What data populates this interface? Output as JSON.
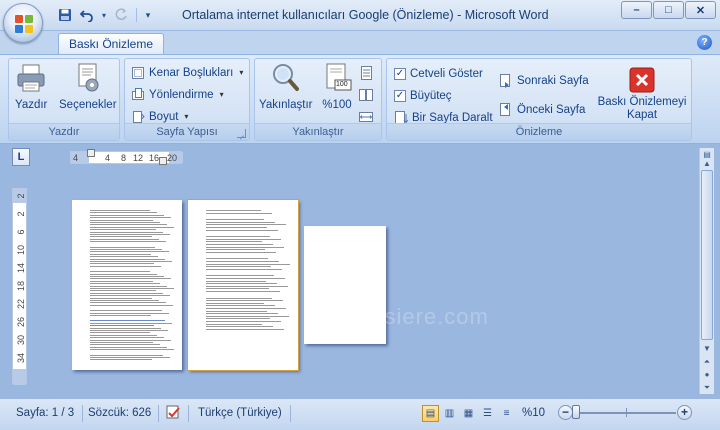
{
  "window": {
    "title": "Ortalama internet kullanıcıları Google (Önizleme) - Microsoft Word",
    "controls": {
      "minimize": "–",
      "maximize": "□",
      "close": "✕"
    }
  },
  "qat": {
    "save_icon": "save-icon",
    "undo_icon": "undo-icon",
    "redo_icon": "redo-icon"
  },
  "ribbon": {
    "active_tab": "Baskı Önizleme",
    "help_label": "?",
    "groups": {
      "print": {
        "label": "Yazdır",
        "print_button": "Yazdır",
        "options_button": "Seçenekler"
      },
      "page_setup": {
        "label": "Sayfa Yapısı",
        "margins": "Kenar Boşlukları",
        "orientation": "Yönlendirme",
        "size": "Boyut"
      },
      "zoom": {
        "label": "Yakınlaştır",
        "zoom_button": "Yakınlaştır",
        "zoom100_button": "%100",
        "zoom100_badge": "100"
      },
      "preview": {
        "label": "Önizleme",
        "show_ruler": "Cetveli Göster",
        "magnifier": "Büyüteç",
        "shrink_one_page": "Bir Sayfa Daralt",
        "next_page": "Sonraki Sayfa",
        "previous_page": "Önceki Sayfa",
        "close_preview_line1": "Baskı Önizlemeyi",
        "close_preview_line2": "Kapat",
        "show_ruler_checked": true,
        "magnifier_checked": true
      }
    }
  },
  "ruler": {
    "corner_label": "L",
    "h_ticks": [
      "4",
      "4",
      "8",
      "12",
      "16",
      "20"
    ],
    "v_ticks": [
      "2",
      "2",
      "6",
      "10",
      "14",
      "18",
      "22",
      "26",
      "30",
      "34"
    ]
  },
  "watermark": "digitalsiere.com",
  "status": {
    "page": "Sayfa: 1 / 3",
    "words": "Sözcük: 626",
    "language": "Türkçe (Türkiye)",
    "zoom": "%10",
    "zoom_minus": "−",
    "zoom_plus": "+"
  },
  "colors": {
    "accent": "#15428b",
    "doc_background": "#9ab7e0",
    "close_preview_red": "#d9342b"
  }
}
